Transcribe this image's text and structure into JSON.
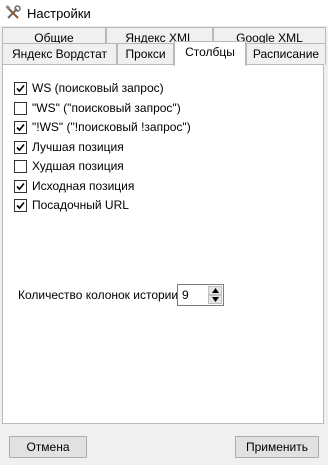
{
  "window": {
    "title": "Настройки"
  },
  "tabs_row1": [
    "Общие",
    "Яндекс XML",
    "Google XML"
  ],
  "tabs_row2": [
    "Яндекс Вордстат",
    "Прокси",
    "Столбцы",
    "Расписание"
  ],
  "active_tab": "Столбцы",
  "columns": [
    {
      "label": "WS (поисковый запрос)",
      "checked": true
    },
    {
      "label": "\"WS\" (\"поисковый запрос\")",
      "checked": false
    },
    {
      "label": "\"!WS\" (\"!поисковый !запрос\")",
      "checked": true
    },
    {
      "label": "Лучшая позиция",
      "checked": true
    },
    {
      "label": "Худшая позиция",
      "checked": false
    },
    {
      "label": "Исходная позиция",
      "checked": true
    },
    {
      "label": "Посадочный URL",
      "checked": true
    }
  ],
  "history": {
    "label": "Количество колонок истории:",
    "value": "9"
  },
  "buttons": {
    "cancel": "Отмена",
    "apply": "Применить"
  }
}
